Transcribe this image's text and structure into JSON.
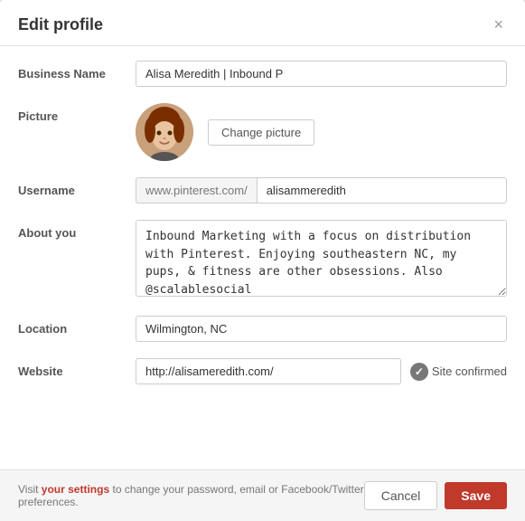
{
  "modal": {
    "title": "Edit profile",
    "close_label": "×"
  },
  "form": {
    "business_name_label": "Business Name",
    "business_name_value": "Alisa Meredith | Inbound P",
    "picture_label": "Picture",
    "change_picture_label": "Change picture",
    "username_label": "Username",
    "username_prefix": "www.pinterest.com/",
    "username_value": "alisammeredith",
    "about_label": "About you",
    "about_value": "Inbound Marketing with a focus on distribution with Pinterest. Enjoying southeastern NC, my pups, & fitness are other obsessions. Also @scalablesocial",
    "location_label": "Location",
    "location_value": "Wilmington, NC",
    "website_label": "Website",
    "website_value": "http://alisameredith.com/",
    "site_confirmed_label": "Site confirmed"
  },
  "footer": {
    "note_text": "Visit ",
    "note_link": "your settings",
    "note_rest": " to change your password, email or Facebook/Twitter preferences.",
    "cancel_label": "Cancel",
    "save_label": "Save"
  }
}
